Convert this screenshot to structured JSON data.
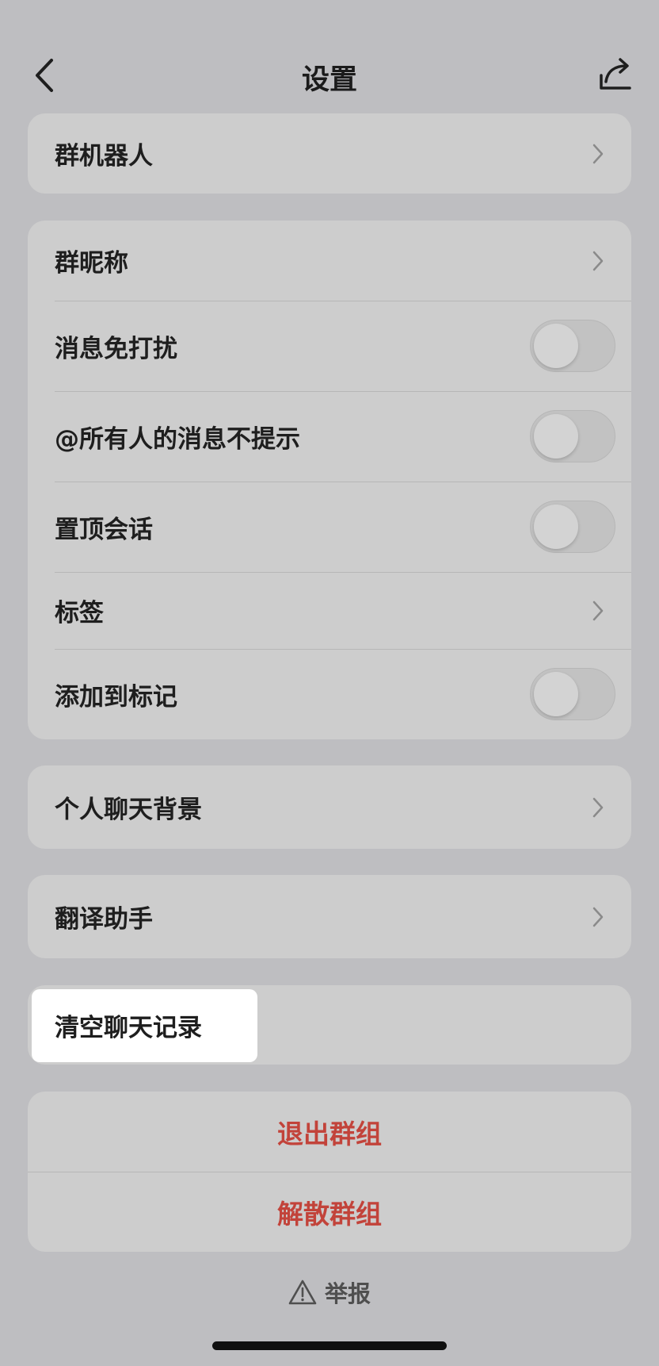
{
  "header": {
    "title": "设置",
    "back_icon": "chevron-left-icon",
    "share_icon": "share-icon"
  },
  "groups": {
    "bot": {
      "label": "群机器人"
    },
    "settings": {
      "nickname": "群昵称",
      "mute": "消息免打扰",
      "at_all_mute": "@所有人的消息不提示",
      "pin": "置顶会话",
      "tags": "标签",
      "add_mark": "添加到标记"
    },
    "background": {
      "label": "个人聊天背景"
    },
    "translate": {
      "label": "翻译助手"
    },
    "clear": {
      "label": "清空聊天记录"
    },
    "danger": {
      "leave": "退出群组",
      "dissolve": "解散群组"
    }
  },
  "toggles": {
    "mute": false,
    "at_all_mute": false,
    "pin": false,
    "add_mark": false
  },
  "report": {
    "label": "举报",
    "icon": "warning-icon"
  },
  "colors": {
    "background": "#bebec1",
    "card": "#cdcdcd",
    "danger_text": "#c2433a",
    "highlight": "#ffffff"
  }
}
